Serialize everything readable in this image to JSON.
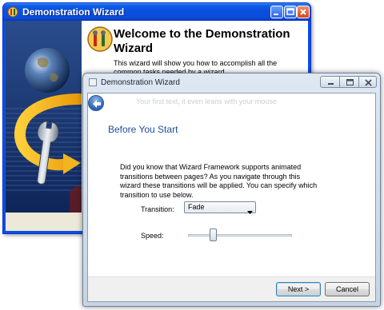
{
  "back_window": {
    "title": "Demonstration Wizard",
    "heading": "Welcome to the Demonstration Wizard",
    "description": "This wizard will show you how to accomplish all the common tasks needed by a wizard."
  },
  "front_window": {
    "title": "Demonstration Wizard",
    "ghost_text": "Your first text, it even leans with your mouse",
    "page_title": "Before You Start",
    "intro": "Did you know that Wizard Framework supports animated transitions between pages? As you navigate through this wizard these transitions will be applied. You can specify which transition to use below.",
    "transition": {
      "label": "Transition:",
      "value": "Fade"
    },
    "speed": {
      "label": "Speed:",
      "value_fraction": 0.22
    },
    "buttons": {
      "next": "Next >",
      "cancel": "Cancel"
    }
  },
  "icons": {
    "back_window_app": "wizard-icon",
    "back_window_heading": "wizard-tools-icon",
    "back_window_banner": "globe-arrow-wrench-illustration",
    "front_window_app": "window-icon",
    "back_nav": "back-arrow-icon",
    "dropdown": "chevron-down-icon"
  },
  "colors": {
    "xp_titlebar": "#0a4fe0",
    "vista_frame": "#c6d4e4",
    "page_title": "#1e4d99",
    "banner_blue": "#1a3a7a"
  }
}
